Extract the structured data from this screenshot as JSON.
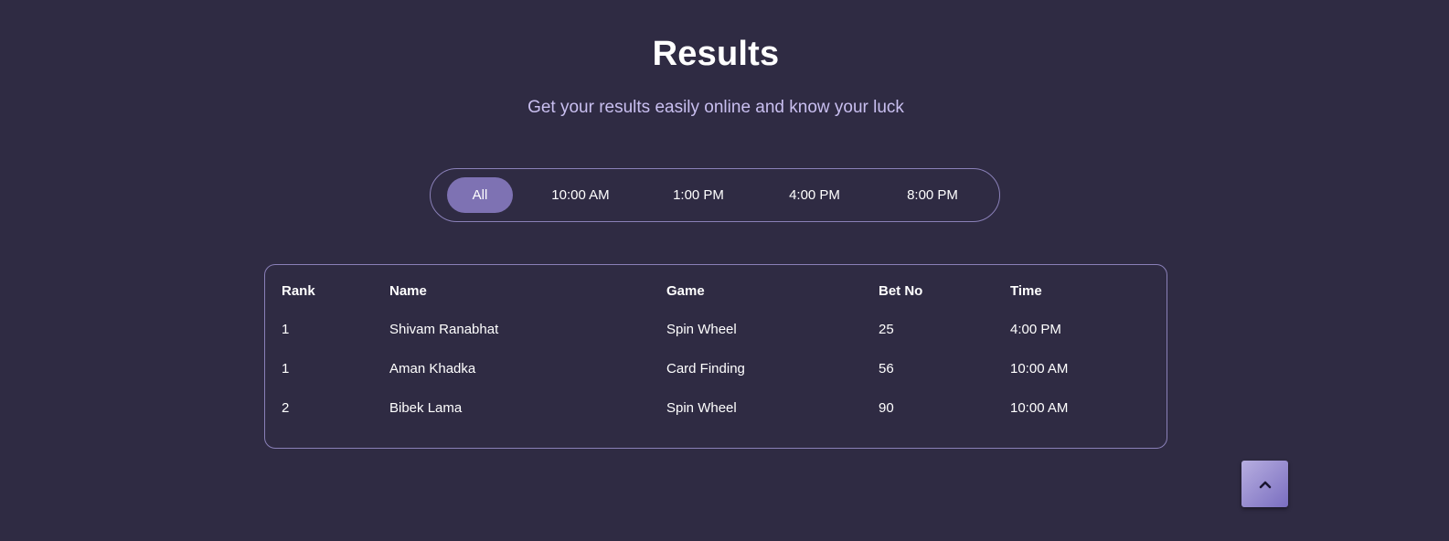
{
  "header": {
    "title": "Results",
    "subtitle": "Get your results easily online and know your luck"
  },
  "filters": {
    "selected": "All",
    "items": [
      "All",
      "10:00 AM",
      "1:00 PM",
      "4:00 PM",
      "8:00 PM"
    ]
  },
  "table": {
    "columns": [
      "Rank",
      "Name",
      "Game",
      "Bet No",
      "Time"
    ],
    "rows": [
      [
        "1",
        "Shivam Ranabhat",
        "Spin Wheel",
        "25",
        "4:00 PM"
      ],
      [
        "1",
        "Aman Khadka",
        "Card Finding",
        "56",
        "10:00 AM"
      ],
      [
        "2",
        "Bibek Lama",
        "Spin Wheel",
        "90",
        "10:00 AM"
      ]
    ]
  },
  "scroll_top": {
    "icon": "chevron-up-icon"
  },
  "colors": {
    "background": "#2f2b43",
    "accent": "#7e72b3",
    "border": "#8a80b8",
    "subtitle": "#c9bff0"
  }
}
